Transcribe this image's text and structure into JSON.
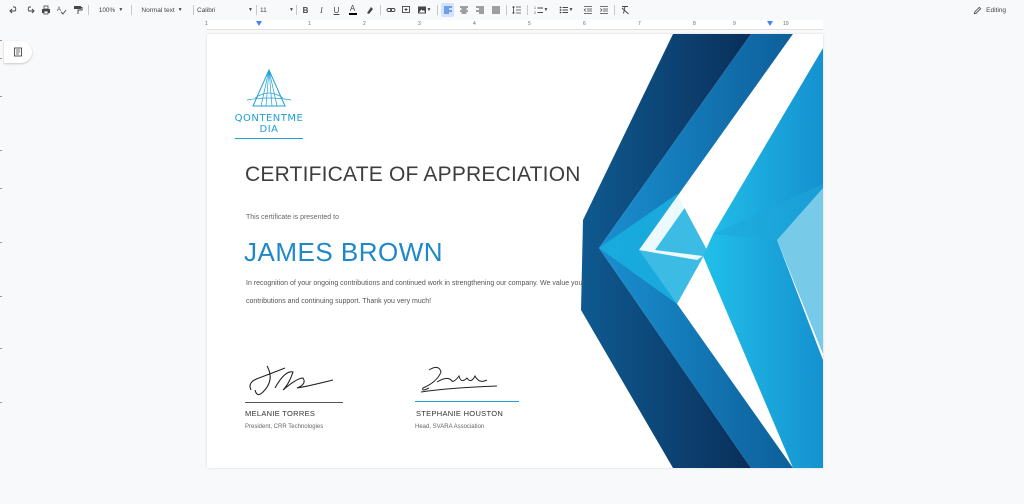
{
  "toolbar": {
    "zoom": "100%",
    "style": "Normal text",
    "font": "Calibri",
    "font_size": "11",
    "mode": "Editing"
  },
  "ruler": {
    "numbers": [
      "1",
      "1",
      "2",
      "3",
      "4",
      "5",
      "6",
      "7",
      "8",
      "9",
      "10"
    ]
  },
  "certificate": {
    "logo": "QONTENTME\nDIA",
    "title": "CERTIFICATE OF APPRECIATION",
    "presented": "This certificate is presented to",
    "name": "JAMES BROWN",
    "body": "In recognition of your ongoing contributions and continued work in strengthening our company. We value your contributions and continuing support. Thank you very much!",
    "signatories": [
      {
        "name": "MELANIE TORRES",
        "role": "President, CRR Technologies"
      },
      {
        "name": "STEPHANIE HOUSTON",
        "role": "Head, SVARA Association"
      }
    ]
  },
  "colors": {
    "accent": "#1e88c8",
    "dark_blue": "#0d3c6e",
    "mid_blue": "#1f7fbf",
    "light_blue": "#1eb5e0"
  },
  "icons": [
    "undo-icon",
    "redo-icon",
    "print-icon",
    "spellcheck-icon",
    "paint-format-icon",
    "bold-icon",
    "italic-icon",
    "underline-icon",
    "text-color-icon",
    "highlight-icon",
    "link-icon",
    "comment-icon",
    "image-icon",
    "align-left-icon",
    "align-center-icon",
    "align-right-icon",
    "justify-icon",
    "line-spacing-icon",
    "numbered-list-icon",
    "bulleted-list-icon",
    "decrease-indent-icon",
    "increase-indent-icon",
    "clear-formatting-icon",
    "pencil-icon",
    "outline-icon"
  ]
}
